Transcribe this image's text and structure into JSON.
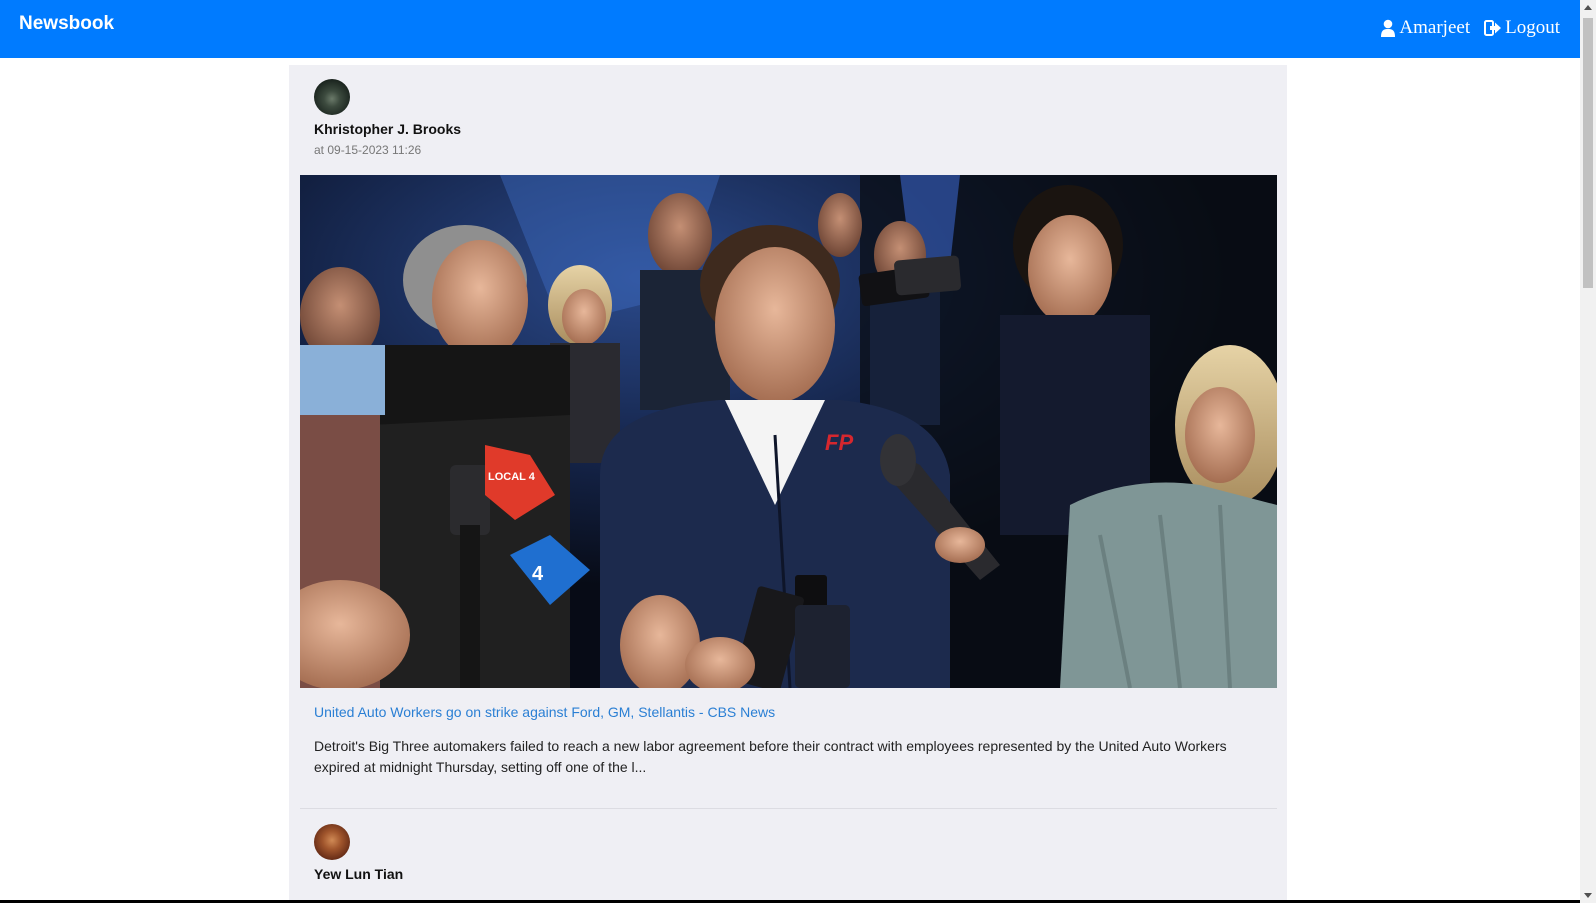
{
  "navbar": {
    "brand": "Newsbook",
    "user_label": "Amarjeet",
    "logout_label": "Logout"
  },
  "posts": [
    {
      "author": "Khristopher J. Brooks",
      "timestamp": "at 09-15-2023 11:26",
      "title": "United Auto Workers go on strike against Ford, GM, Stellantis - CBS News",
      "description": "Detroit's Big Three automakers failed to reach a new labor agreement before their contract with employees represented by the United Auto Workers expired at midnight Thursday, setting off one of the l...",
      "image_texts": {
        "badge_local4": "LOCAL 4",
        "badge_ch4": "4",
        "logo_fp": "FP"
      }
    },
    {
      "author": "Yew Lun Tian"
    }
  ],
  "colors": {
    "navbar": "#007bff",
    "feed_bg": "#efeff4",
    "link": "#2a7fd4"
  }
}
